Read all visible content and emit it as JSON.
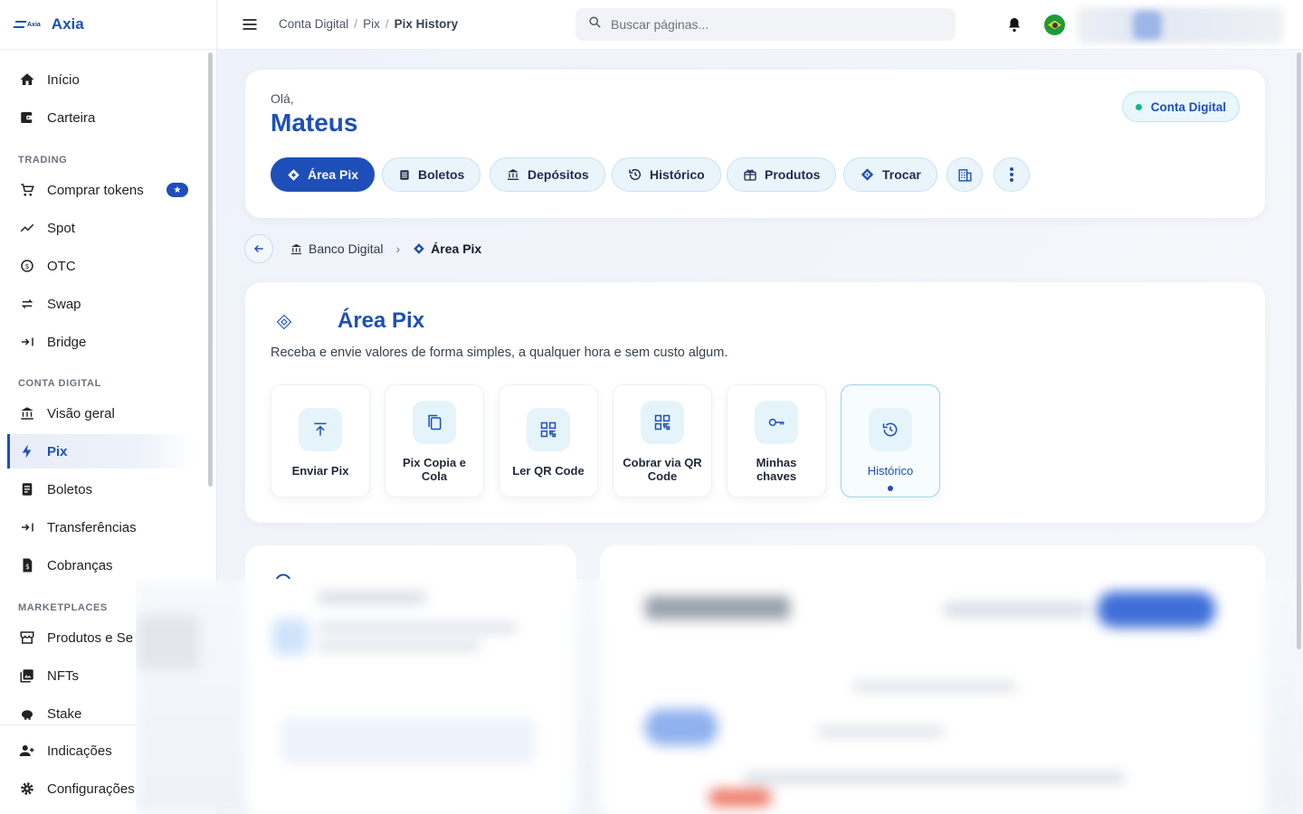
{
  "app": {
    "logo_small": "Axia",
    "logo_name": "Axia"
  },
  "sidebar": {
    "items_top": [
      {
        "label": "Início",
        "icon": "home-icon"
      },
      {
        "label": "Carteira",
        "icon": "wallet-icon"
      }
    ],
    "section_trading": "TRADING",
    "items_trading": [
      {
        "label": "Comprar tokens",
        "icon": "cart-icon",
        "badge": "★"
      },
      {
        "label": "Spot",
        "icon": "trend-icon"
      },
      {
        "label": "OTC",
        "icon": "otc-icon"
      },
      {
        "label": "Swap",
        "icon": "swap-icon"
      },
      {
        "label": "Bridge",
        "icon": "bridge-icon"
      }
    ],
    "section_conta": "CONTA DIGITAL",
    "items_conta": [
      {
        "label": "Visão geral",
        "icon": "bank-icon"
      },
      {
        "label": "Pix",
        "icon": "bolt-icon",
        "active": true
      },
      {
        "label": "Boletos",
        "icon": "document-icon"
      },
      {
        "label": "Transferências",
        "icon": "transfer-icon"
      },
      {
        "label": "Cobranças",
        "icon": "invoice-icon"
      }
    ],
    "section_market": "MARKETPLACES",
    "items_market": [
      {
        "label": "Produtos e Se",
        "icon": "store-icon"
      },
      {
        "label": "NFTs",
        "icon": "image-icon"
      },
      {
        "label": "Stake",
        "icon": "piggy-icon"
      }
    ],
    "items_bottom": [
      {
        "label": "Indicações",
        "icon": "referral-icon"
      },
      {
        "label": "Configurações",
        "icon": "gear-icon"
      }
    ]
  },
  "topbar": {
    "breadcrumb": [
      "Conta Digital",
      "Pix",
      "Pix History"
    ],
    "search_placeholder": "Buscar páginas..."
  },
  "greeting": {
    "hello": "Olá,",
    "name": "Mateus",
    "account_pill": "Conta Digital",
    "tabs": [
      "Área Pix",
      "Boletos",
      "Depósitos",
      "Histórico",
      "Produtos",
      "Trocar"
    ]
  },
  "subcrumb": {
    "parent": "Banco Digital",
    "current": "Área Pix"
  },
  "pix": {
    "title": "Área Pix",
    "description": "Receba e envie valores de forma simples, a qualquer hora e sem custo algum.",
    "tiles": [
      "Enviar Pix",
      "Pix Copia e Cola",
      "Ler QR Code",
      "Cobrar via QR Code",
      "Minhas chaves",
      "Histórico"
    ]
  },
  "colors": {
    "brand": "#1e4fb8",
    "accent_light": "#e4f4fa",
    "online": "#10b981"
  }
}
